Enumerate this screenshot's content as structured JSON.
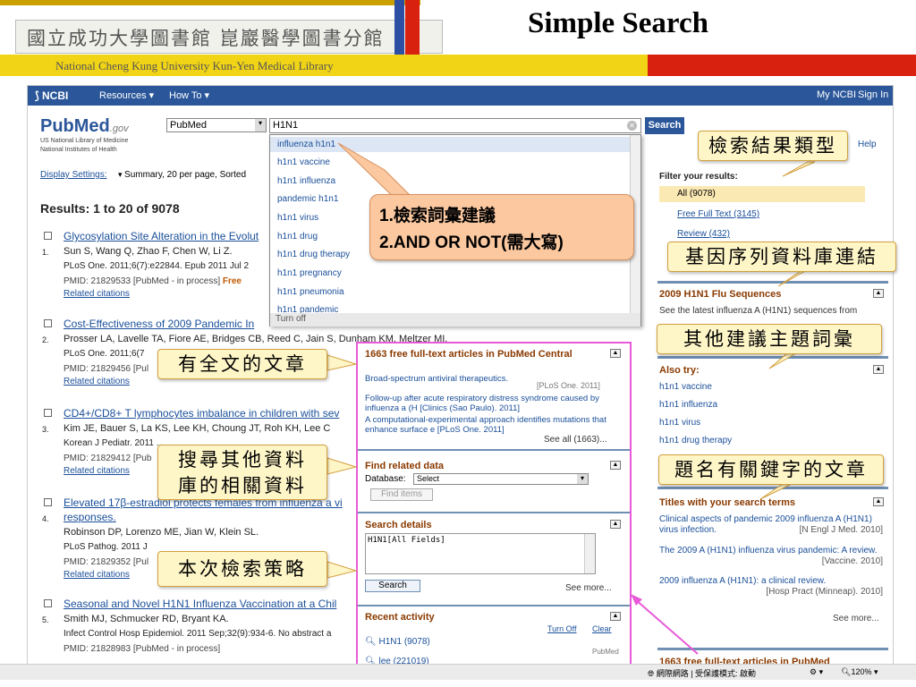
{
  "slide": {
    "title": "Simple Search",
    "logo_zh": "國立成功大學圖書館  崑巖醫學圖書分館",
    "logo_en": "National Cheng Kung University Kun-Yen Medical Library"
  },
  "ncbi": {
    "logo": "NCBI",
    "resources": "Resources",
    "howto": "How To",
    "mynci": "My NCBI",
    "signin": "Sign In"
  },
  "pubmed": {
    "brand": "PubMed",
    "gov": ".gov",
    "nlm": "US National Library of Medicine",
    "nih": "National Institutes of Health",
    "db_select": "PubMed",
    "query": "H1N1",
    "search_btn": "Search",
    "help": "Help"
  },
  "display": {
    "settings": "Display Settings:",
    "summary": "Summary, 20 per page, Sorted"
  },
  "results": {
    "header": "Results: 1 to 20 of 9078"
  },
  "items": [
    {
      "num": "1.",
      "title": "Glycosylation Site Alteration in the Evolut",
      "authors": "Sun S, Wang Q, Zhao F, Chen W, Li Z.",
      "cite": "PLoS One. 2011;6(7):e22844. Epub 2011 Jul 2",
      "pmid": "PMID: 21829533 [PubMed - in process]",
      "free": "Free",
      "related": "Related citations"
    },
    {
      "num": "2.",
      "title": "Cost-Effectiveness of 2009 Pandemic In",
      "authors": "Prosser LA, Lavelle TA, Fiore AE, Bridges CB, Reed C, Jain S, Dunham KM, Meltzer MI.",
      "cite": "PLoS One. 2011;6(7",
      "pmid": "PMID: 21829456 [Pul",
      "related": "Related citations"
    },
    {
      "num": "3.",
      "title": "CD4+/CD8+ T lymphocytes imbalance in children with sev",
      "authors": "Kim JE, Bauer S, La KS, Lee KH, Choung JT, Roh KH, Lee C",
      "cite": "Korean J Pediatr. 2011 ...",
      "pmid": "PMID: 21829412 [Pub",
      "related": "Related citations"
    },
    {
      "num": "4.",
      "title": "Elevated 17β-estradiol protects females from influenza a vi",
      "title2": "responses.",
      "authors": "Robinson DP, Lorenzo ME, Jian W, Klein SL.",
      "cite": "PLoS Pathog. 2011 J",
      "pmid": "PMID: 21829352 [Pul",
      "related": "Related citations"
    },
    {
      "num": "5.",
      "title": "Seasonal and Novel H1N1 Influenza Vaccination at a Chil",
      "authors": "Smith MJ, Schmucker RD, Bryant KA.",
      "cite": "Infect Control Hosp Epidemiol. 2011 Sep;32(9):934-6. No abstract a",
      "pmid": "PMID: 21828983 [PubMed - in process]"
    }
  ],
  "dropdown": [
    "influenza h1n1",
    "h1n1 vaccine",
    "h1n1 influenza",
    "pandemic h1n1",
    "h1n1 virus",
    "h1n1 drug",
    "h1n1 drug therapy",
    "h1n1 pregnancy",
    "h1n1 pneumonia",
    "h1n1 pandemic"
  ],
  "dropdown_off": "Turn off",
  "filter": {
    "head": "Filter your results:",
    "all": "All (9078)",
    "free": "Free Full Text (3145)",
    "review": "Review (432)"
  },
  "flu": {
    "head": "2009 H1N1 Flu Sequences",
    "desc": "See the latest influenza A (H1N1) sequences from"
  },
  "also": {
    "head": "Also try:",
    "items": [
      "h1n1 vaccine",
      "h1n1 influenza",
      "h1n1 virus",
      "h1n1 drug therapy"
    ]
  },
  "titles": {
    "head": "Titles with your search terms",
    "a": "Clinical aspects of pandemic 2009 influenza A (H1N1) virus infection.",
    "a_src": "[N Engl J Med. 2010]",
    "b": "The 2009 A (H1N1) influenza virus pandemic: A review.",
    "b_src": "[Vaccine. 2010]",
    "c": "2009 influenza A (H1N1): a clinical review.",
    "c_src": "[Hosp Pract (Minneap). 2010]",
    "more": "See more..."
  },
  "ft_bottom": "1663 free full-text articles in PubMed",
  "pink": {
    "ft_head": "1663 free full-text articles in PubMed Central",
    "ft1": "Broad-spectrum antiviral therapeutics.",
    "ft1_src": "[PLoS One. 2011]",
    "ft2": "Follow-up after acute respiratory distress syndrome caused by influenza a (H [Clinics (Sao Paulo). 2011]",
    "ft3": "A computational-experimental approach identifies mutations that enhance surface e [PLoS One. 2011]",
    "ft_all": "See all (1663)...",
    "rel_head": "Find related data",
    "db_label": "Database:",
    "db_val": "Select",
    "find": "Find items",
    "sd_head": "Search details",
    "sd_text": "H1N1[All Fields]",
    "sd_btn": "Search",
    "sd_more": "See more...",
    "ra_head": "Recent activity",
    "ra_off": "Turn Off",
    "ra_clear": "Clear",
    "ra1": "H1N1 (9078)",
    "ra2": "lee (221019)",
    "ra_db": "PubMed"
  },
  "callouts": {
    "c1": "檢索結果類型",
    "c2": "基因序列資料庫連結",
    "c3": "其他建議主題詞彙",
    "c4": "題名有關鍵字的文章",
    "c5": "有全文的文章",
    "c6a": "搜尋其他資料",
    "c6b": "庫的相關資料",
    "c7": "本次檢索策略",
    "o1": "1.檢索詞彙建議",
    "o2": "2.AND OR NOT(需大寫)"
  },
  "status": {
    "zone": "網際網路 | 受保護模式: 啟動",
    "zoom": "120%"
  }
}
